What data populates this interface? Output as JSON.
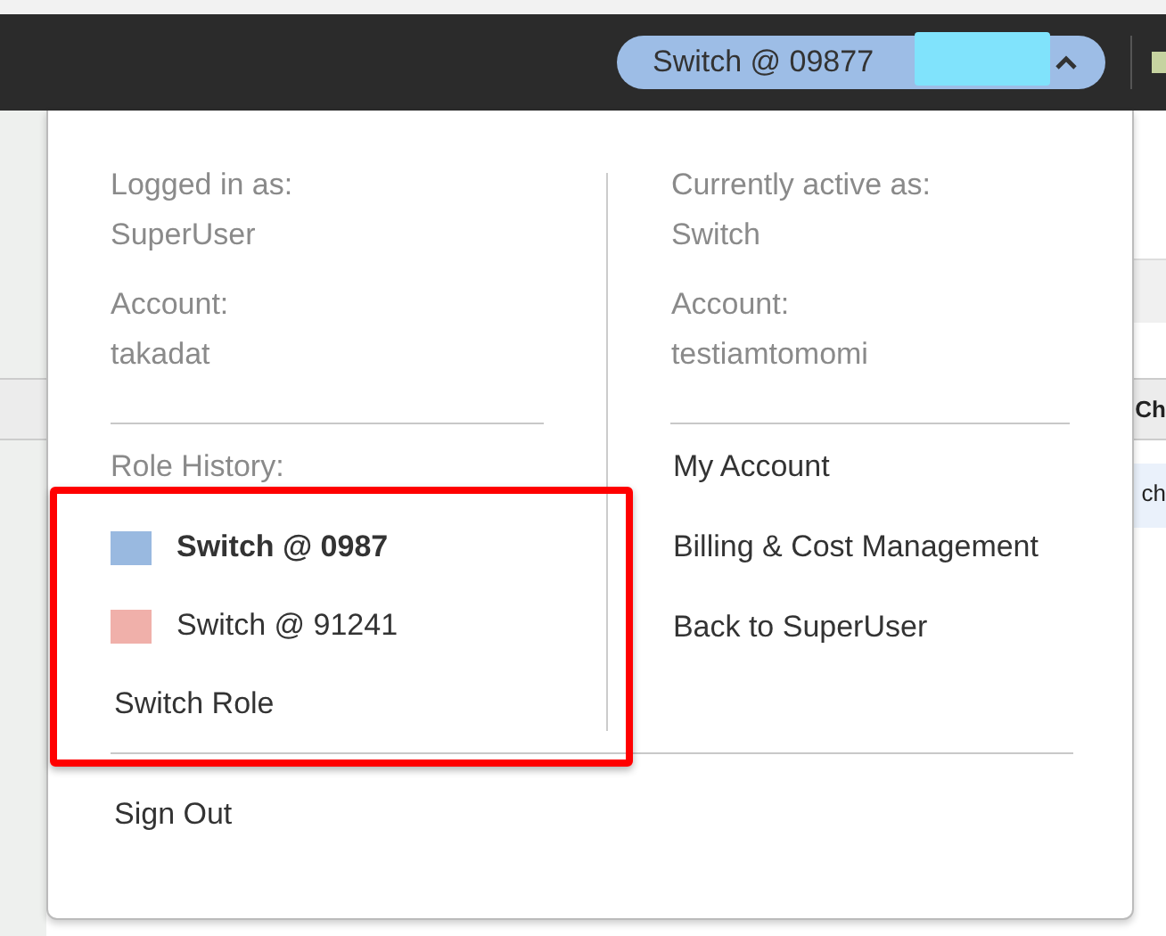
{
  "top_bar": {
    "account_menu": {
      "label": "Switch @ 09877",
      "expanded": true
    }
  },
  "background_table": {
    "header_cell": "Ch",
    "row_cell": "ch"
  },
  "menu": {
    "left": [
      {
        "label": "Logged in as:",
        "value": "SuperUser"
      },
      {
        "label": "Account:",
        "value": "takadat"
      }
    ],
    "right": [
      {
        "label": "Currently active as:",
        "value": "Switch"
      },
      {
        "label": "Account:",
        "value": "testiamtomomi"
      }
    ],
    "role_history": {
      "title": "Role History:",
      "roles": [
        {
          "label": "Switch @ 0987",
          "color": "#99b9e0",
          "selected": true
        },
        {
          "label": "Switch @ 91241",
          "color": "#f0b0aa",
          "selected": false
        }
      ],
      "switch_role": "Switch Role"
    },
    "links": [
      "My Account",
      "Billing & Cost Management",
      "Back to SuperUser"
    ],
    "sign_out": "Sign Out"
  }
}
